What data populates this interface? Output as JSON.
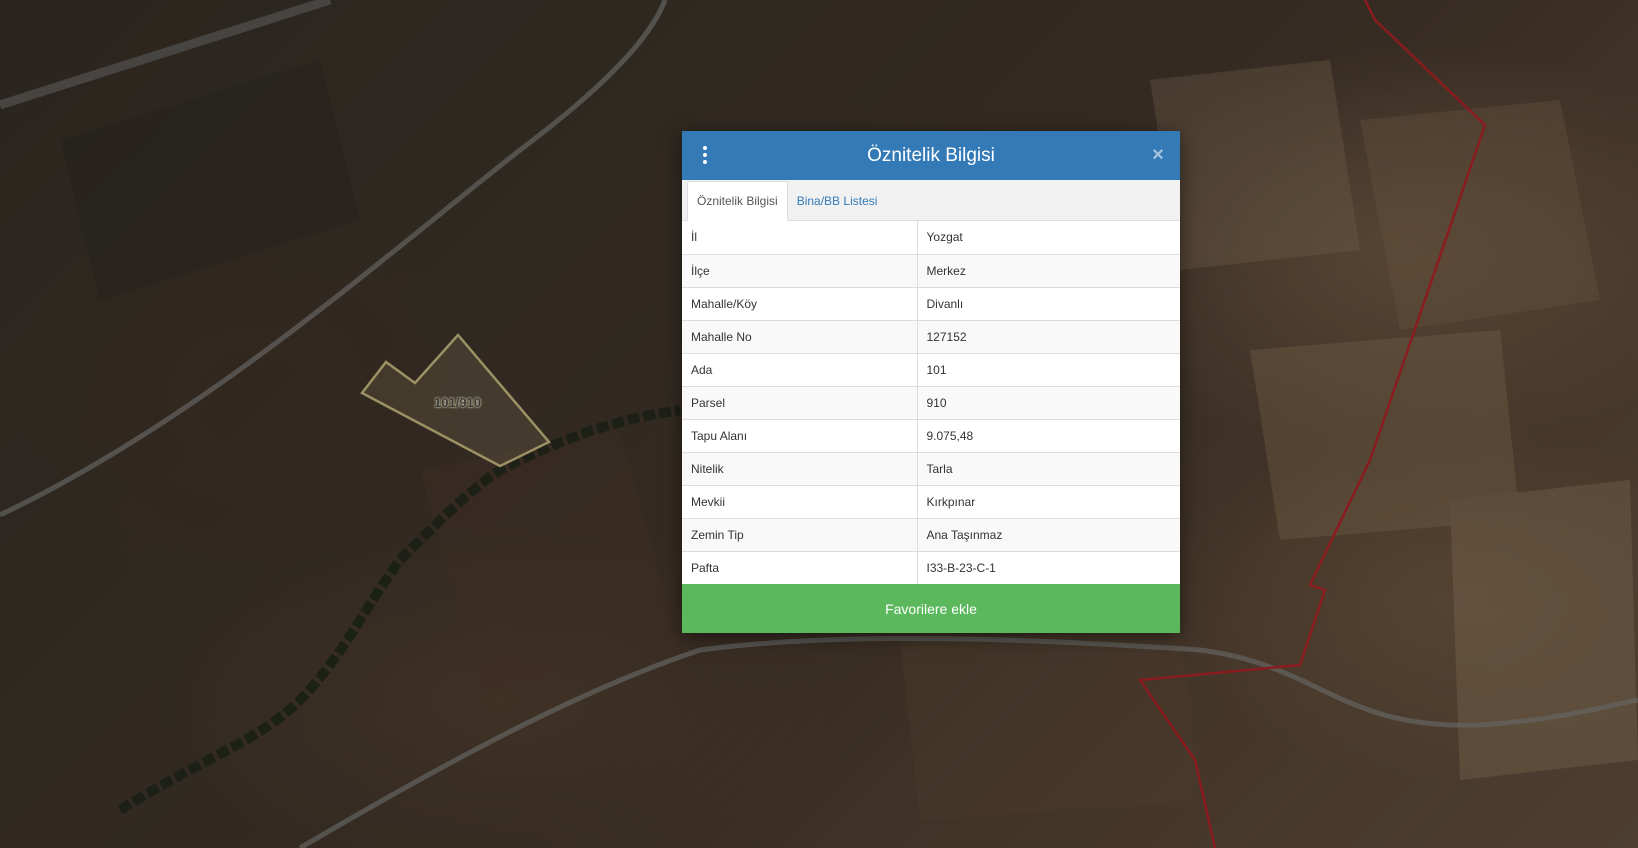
{
  "map": {
    "parcel_label": "101/910",
    "colors": {
      "parcel_outline": "#d8c98a",
      "boundary_line": "#c0262b",
      "road": "#8a8a88"
    }
  },
  "modal": {
    "title": "Öznitelik Bilgisi",
    "menu_icon": "vertical-dots-icon",
    "close_icon": "close-icon",
    "close_label": "×",
    "tabs": [
      {
        "label": "Öznitelik Bilgisi",
        "active": true
      },
      {
        "label": "Bina/BB Listesi",
        "active": false
      }
    ],
    "rows": [
      {
        "key": "İl",
        "value": "Yozgat"
      },
      {
        "key": "İlçe",
        "value": "Merkez"
      },
      {
        "key": "Mahalle/Köy",
        "value": "Divanlı"
      },
      {
        "key": "Mahalle No",
        "value": "127152"
      },
      {
        "key": "Ada",
        "value": "101"
      },
      {
        "key": "Parsel",
        "value": "910"
      },
      {
        "key": "Tapu Alanı",
        "value": "9.075,48"
      },
      {
        "key": "Nitelik",
        "value": "Tarla"
      },
      {
        "key": "Mevkii",
        "value": "Kırkpınar"
      },
      {
        "key": "Zemin Tip",
        "value": "Ana Taşınmaz"
      },
      {
        "key": "Pafta",
        "value": "I33-B-23-C-1"
      }
    ],
    "favorite_button": "Favorilere ekle",
    "colors": {
      "header": "#337ab7",
      "favorite_button": "#5cb85c"
    }
  }
}
